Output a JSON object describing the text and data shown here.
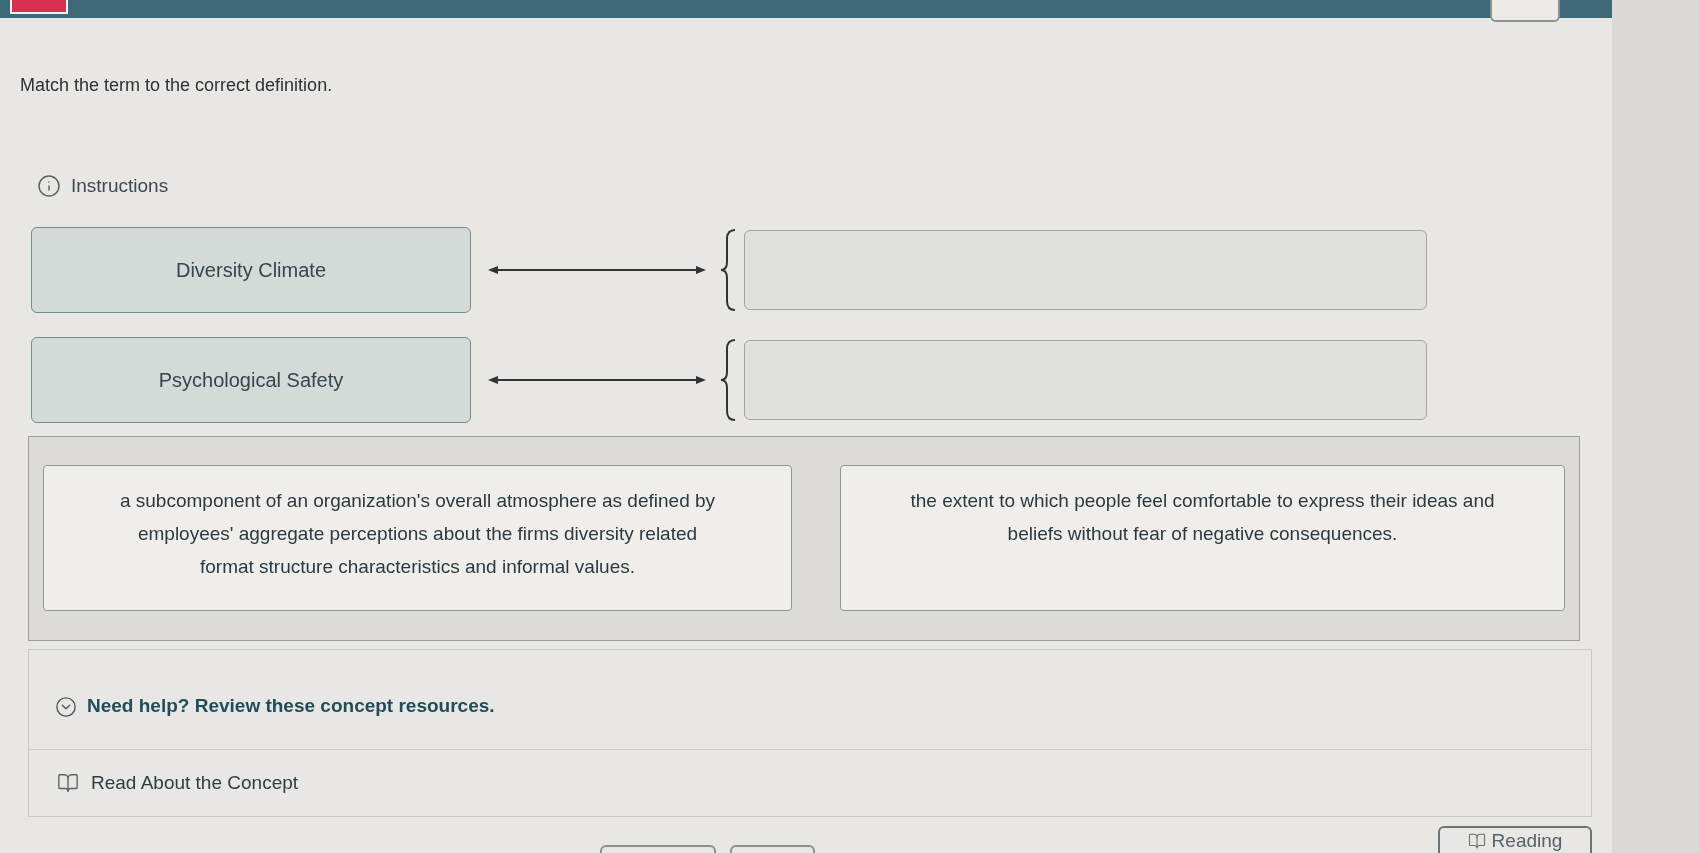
{
  "prompt": "Match the term to the correct definition.",
  "instructions": {
    "label": "Instructions"
  },
  "pairs": [
    {
      "term": "Diversity Climate"
    },
    {
      "term": "Psychological Safety"
    }
  ],
  "definitions": [
    "a subcomponent of an organization's overall atmosphere as defined by employees' aggregate perceptions about the firms diversity related format structure characteristics and informal values.",
    "the extent to which people feel comfortable to express their ideas and beliefs without fear of negative consequences."
  ],
  "help": {
    "title": "Need help? Review these concept resources.",
    "expanded": true,
    "resources": [
      {
        "label": "Read About the Concept"
      }
    ]
  },
  "footer": {
    "reading_button": "Reading"
  }
}
